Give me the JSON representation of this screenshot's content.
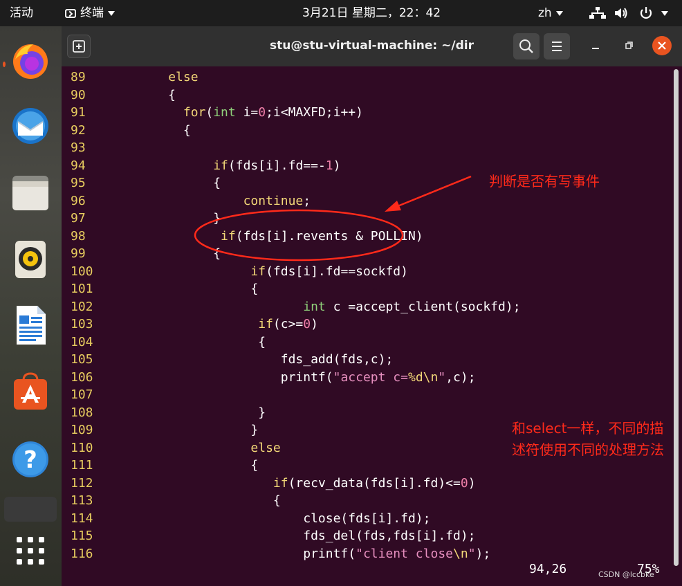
{
  "topbar": {
    "activities": "活动",
    "app_name": "终端",
    "clock": "3月21日 星期二，22：42",
    "input_method": "zh"
  },
  "window": {
    "title": "stu@stu-virtual-machine: ~/dir"
  },
  "code_lines": [
    {
      "n": "89",
      "segs": [
        {
          "t": "     "
        },
        {
          "t": "else",
          "c": "kw"
        }
      ]
    },
    {
      "n": "90",
      "segs": [
        {
          "t": "     {"
        }
      ]
    },
    {
      "n": "91",
      "segs": [
        {
          "t": "       "
        },
        {
          "t": "for",
          "c": "kw"
        },
        {
          "t": "("
        },
        {
          "t": "int",
          "c": "ty"
        },
        {
          "t": " i="
        },
        {
          "t": "0",
          "c": "num"
        },
        {
          "t": ";i<MAXFD;i++)"
        }
      ]
    },
    {
      "n": "92",
      "segs": [
        {
          "t": "       {"
        }
      ]
    },
    {
      "n": "93",
      "segs": [
        {
          "t": ""
        }
      ]
    },
    {
      "n": "94",
      "segs": [
        {
          "t": "           "
        },
        {
          "t": "if",
          "c": "kw"
        },
        {
          "t": "(fds[i].fd==-"
        },
        {
          "t": "1",
          "c": "num"
        },
        {
          "t": ")"
        }
      ]
    },
    {
      "n": "95",
      "segs": [
        {
          "t": "           {"
        }
      ]
    },
    {
      "n": "96",
      "segs": [
        {
          "t": "               "
        },
        {
          "t": "continue",
          "c": "kw"
        },
        {
          "t": ";"
        }
      ]
    },
    {
      "n": "97",
      "segs": [
        {
          "t": "           }"
        }
      ]
    },
    {
      "n": "98",
      "segs": [
        {
          "t": "            "
        },
        {
          "t": "if",
          "c": "kw"
        },
        {
          "t": "(fds[i].revents & POLLIN)"
        }
      ]
    },
    {
      "n": "99",
      "segs": [
        {
          "t": "           {"
        }
      ]
    },
    {
      "n": "100",
      "segs": [
        {
          "t": "                "
        },
        {
          "t": "if",
          "c": "kw"
        },
        {
          "t": "(fds[i].fd==sockfd)"
        }
      ]
    },
    {
      "n": "101",
      "segs": [
        {
          "t": "                {"
        }
      ]
    },
    {
      "n": "102",
      "segs": [
        {
          "t": "                       "
        },
        {
          "t": "int",
          "c": "ty"
        },
        {
          "t": " c =accept_client(sockfd);"
        }
      ]
    },
    {
      "n": "103",
      "segs": [
        {
          "t": "                 "
        },
        {
          "t": "if",
          "c": "kw"
        },
        {
          "t": "(c>="
        },
        {
          "t": "0",
          "c": "num"
        },
        {
          "t": ")"
        }
      ]
    },
    {
      "n": "104",
      "segs": [
        {
          "t": "                 {"
        }
      ]
    },
    {
      "n": "105",
      "segs": [
        {
          "t": "                    fds_add(fds,c);"
        }
      ]
    },
    {
      "n": "106",
      "segs": [
        {
          "t": "                    printf("
        },
        {
          "t": "\"accept c=",
          "c": "str"
        },
        {
          "t": "%d\\n",
          "c": "kw"
        },
        {
          "t": "\"",
          "c": "str"
        },
        {
          "t": ",c);"
        }
      ]
    },
    {
      "n": "107",
      "segs": [
        {
          "t": ""
        }
      ]
    },
    {
      "n": "108",
      "segs": [
        {
          "t": "                 }"
        }
      ]
    },
    {
      "n": "109",
      "segs": [
        {
          "t": "                }"
        }
      ]
    },
    {
      "n": "110",
      "segs": [
        {
          "t": "                "
        },
        {
          "t": "else",
          "c": "kw"
        }
      ]
    },
    {
      "n": "111",
      "segs": [
        {
          "t": "                {"
        }
      ]
    },
    {
      "n": "112",
      "segs": [
        {
          "t": "                   "
        },
        {
          "t": "if",
          "c": "kw"
        },
        {
          "t": "(recv_data(fds[i].fd)<="
        },
        {
          "t": "0",
          "c": "num"
        },
        {
          "t": ")"
        }
      ]
    },
    {
      "n": "113",
      "segs": [
        {
          "t": "                   {"
        }
      ]
    },
    {
      "n": "114",
      "segs": [
        {
          "t": "                       close(fds[i].fd);"
        }
      ]
    },
    {
      "n": "115",
      "segs": [
        {
          "t": "                       fds_del(fds,fds[i].fd);"
        }
      ]
    },
    {
      "n": "116",
      "segs": [
        {
          "t": "                       printf("
        },
        {
          "t": "\"client close",
          "c": "str"
        },
        {
          "t": "\\n",
          "c": "kw"
        },
        {
          "t": "\"",
          "c": "str"
        },
        {
          "t": ");"
        }
      ]
    }
  ],
  "status": {
    "cursor": "94,26",
    "percent": "75%"
  },
  "annotations": {
    "write_event": "判断是否有写事件",
    "note_line1": "和select一样，不同的描",
    "note_line2": "述符使用不同的处理方法"
  },
  "watermark": "CSDN @lccbke",
  "colors": {
    "terminal_bg": "#300a24",
    "line_number": "#e7cc5f",
    "keyword": "#f3d878",
    "type": "#8fd07a",
    "number": "#ef7fa9",
    "annotation": "#ff2a1a",
    "close_button": "#e95420"
  },
  "icons": {
    "dock": [
      "firefox-icon",
      "thunderbird-icon",
      "files-icon",
      "rhythmbox-icon",
      "libreoffice-writer-icon",
      "software-center-icon",
      "help-icon",
      "show-apps-icon"
    ],
    "tray": [
      "network-icon",
      "volume-icon",
      "power-icon"
    ]
  }
}
